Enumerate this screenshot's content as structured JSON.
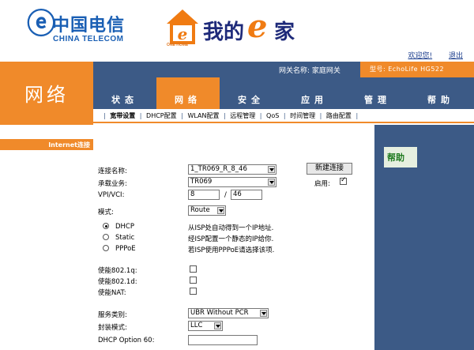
{
  "brand": {
    "logo_mark": "ⓔ",
    "logo_cn": "中国电信",
    "logo_en": "CHINA TELECOM",
    "product_sub": "ONE HOME",
    "product_text1": "我的",
    "product_e": "e",
    "product_text2": "家"
  },
  "top_links": {
    "welcome": "欢迎您!",
    "logout": "退出"
  },
  "section_title": "网络",
  "info_bar": {
    "gateway_name": "网关名称: 家庭网关",
    "model": "型号: EchoLife HG522"
  },
  "main_nav": [
    {
      "label": "状态",
      "active": false
    },
    {
      "label": "网络",
      "active": true
    },
    {
      "label": "安全",
      "active": false
    },
    {
      "label": "应用",
      "active": false
    },
    {
      "label": "管理",
      "active": false
    },
    {
      "label": "帮助",
      "active": false
    }
  ],
  "sub_nav": [
    {
      "label": "宽带设置",
      "active": true
    },
    {
      "label": "DHCP配置",
      "active": false
    },
    {
      "label": "WLAN配置",
      "active": false
    },
    {
      "label": "远程管理",
      "active": false
    },
    {
      "label": "QoS",
      "active": false
    },
    {
      "label": "时间管理",
      "active": false
    },
    {
      "label": "路由配置",
      "active": false
    }
  ],
  "sidebar": {
    "item": "Internet连接"
  },
  "form": {
    "conn_name_label": "连接名称:",
    "conn_name_value": "1_TR069_R_8_46",
    "new_conn_button": "新建连接",
    "service_label": "承载业务:",
    "service_value": "TR069",
    "enable_label": "启用:",
    "enable_checked": true,
    "vpi_label": "VPI/VCI:",
    "vpi_value": "8",
    "vci_sep": "/",
    "vci_value": "46",
    "mode_label": "模式:",
    "mode_value": "Route",
    "radios": [
      {
        "label": "DHCP",
        "desc": "从ISP处自动得到一个IP地址.",
        "checked": true
      },
      {
        "label": "Static",
        "desc": "经ISP配置一个静态的IP给你.",
        "checked": false
      },
      {
        "label": "PPPoE",
        "desc": "若ISP使用PPPoE请选择该项.",
        "checked": false
      }
    ],
    "checks": [
      {
        "label": "使能802.1q:",
        "checked": false
      },
      {
        "label": "使能802.1d:",
        "checked": false
      },
      {
        "label": "使能NAT:",
        "checked": false
      }
    ],
    "service_type_label": "服务类别:",
    "service_type_value": "UBR Without PCR",
    "encap_label": "封装模式:",
    "encap_value": "LLC",
    "dhcp60_label": "DHCP Option 60:",
    "dhcp60_value": ""
  },
  "help": {
    "title": "帮助"
  },
  "colors": {
    "orange": "#f08a2a",
    "navy": "#3c5a86",
    "brand_blue": "#1a5fb4"
  },
  "icons": {
    "house": "house-icon",
    "dropdown": "chevron-down-icon"
  }
}
